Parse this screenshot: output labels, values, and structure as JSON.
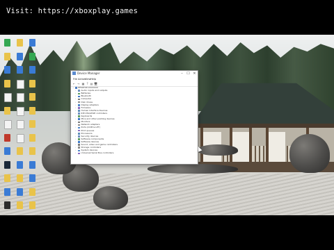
{
  "caption": {
    "text": "Visit: https://xboxplay.games"
  },
  "window": {
    "title": "Device Manager",
    "controls": {
      "minimize": "–",
      "maximize": "☐",
      "close": "✕"
    },
    "menu": [
      "File",
      "Action",
      "View",
      "Help"
    ],
    "toolbar": [
      "←",
      "→",
      "▦",
      "?",
      "▤",
      "🖥"
    ],
    "tree_root": "DESKTOP-XXXXXXX",
    "devices": [
      "Audio inputs and outputs",
      "Batteries",
      "Bluetooth",
      "Computer",
      "Disk drives",
      "Display adapters",
      "Firmware",
      "Human Interface Devices",
      "IDE ATA/ATAPI controllers",
      "Keyboards",
      "Mice and other pointing devices",
      "Monitors",
      "Network adapters",
      "Ports (COM & LPT)",
      "Print queues",
      "Processors",
      "Security devices",
      "Software components",
      "Software devices",
      "Sound, video and game controllers",
      "Storage controllers",
      "System devices",
      "Universal Serial Bus controllers"
    ]
  },
  "desktop": {
    "icons_left": [
      "chrome-icon",
      "folder-icon",
      "app-icon",
      "folder-icon",
      "document-icon",
      "folder-icon",
      "document-icon",
      "game-icon",
      "app-icon",
      "steam-icon",
      "folder-icon",
      "app-icon",
      "epic-icon"
    ],
    "icons_mid": [
      "folder-icon",
      "app-icon",
      "app-icon",
      "document-icon",
      "document-icon",
      "document-icon",
      "document-icon",
      "document-icon",
      "folder-icon",
      "app-icon",
      "folder-icon",
      "app-icon",
      "folder-icon"
    ],
    "icons_right": [
      "app-icon",
      "chrome-icon",
      "app-icon",
      "folder-icon",
      "folder-icon",
      "folder-icon",
      "folder-icon",
      "folder-icon",
      "folder-icon",
      "app-icon",
      "app-icon",
      "folder-icon",
      "folder-icon"
    ]
  }
}
